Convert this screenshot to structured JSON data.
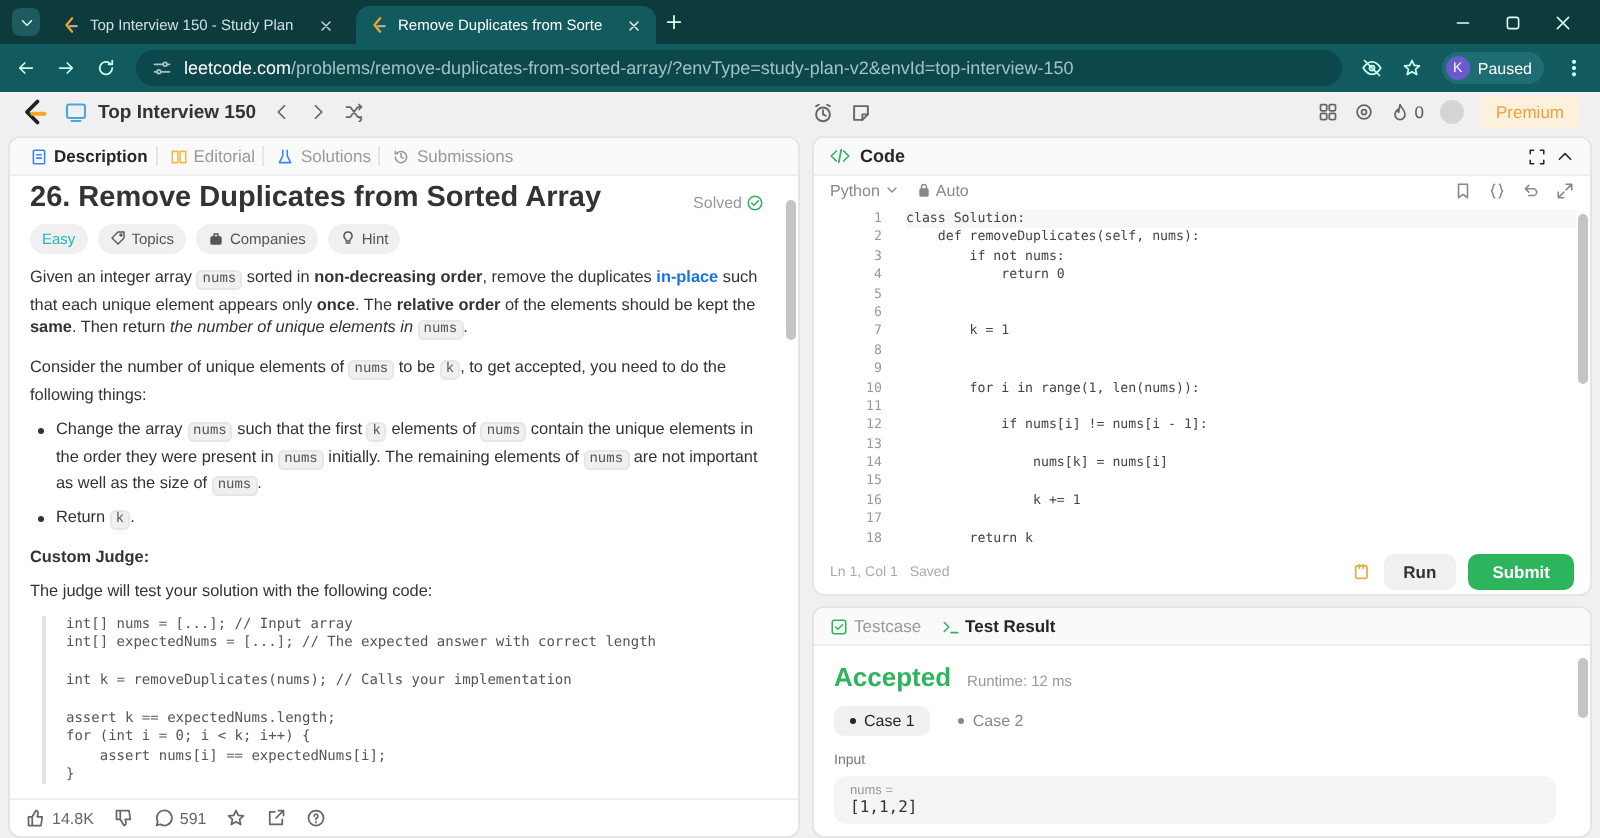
{
  "browser": {
    "tabs": [
      {
        "title": "Top Interview 150 - Study Plan",
        "selected": false
      },
      {
        "title": "Remove Duplicates from Sorte",
        "selected": true
      }
    ],
    "url_domain": "leetcode.com",
    "url_path": "/problems/remove-duplicates-from-sorted-array/?envType=study-plan-v2&envId=top-interview-150",
    "profile": {
      "initial": "K",
      "status": "Paused"
    }
  },
  "app_header": {
    "study_plan": "Top Interview 150",
    "streak": "0",
    "premium": "Premium"
  },
  "left_tabs": [
    {
      "label": "Description",
      "selected": true
    },
    {
      "label": "Editorial",
      "selected": false
    },
    {
      "label": "Solutions",
      "selected": false
    },
    {
      "label": "Submissions",
      "selected": false
    }
  ],
  "problem": {
    "title": "26. Remove Duplicates from Sorted Array",
    "status": "Solved",
    "difficulty": "Easy",
    "tags": [
      "Topics",
      "Companies",
      "Hint"
    ],
    "paragraphs": [
      [
        {
          "kind": "plain",
          "text": "Given an integer array "
        },
        {
          "kind": "code",
          "text": "nums"
        },
        {
          "kind": "plain",
          "text": " sorted in "
        },
        {
          "kind": "bold",
          "text": "non-decreasing order"
        },
        {
          "kind": "plain",
          "text": ", remove the duplicates "
        },
        {
          "kind": "link",
          "text": "in-place"
        },
        {
          "kind": "plain",
          "text": " such that each unique element appears only "
        },
        {
          "kind": "bold",
          "text": "once"
        },
        {
          "kind": "plain",
          "text": ". The "
        },
        {
          "kind": "bold",
          "text": "relative order"
        },
        {
          "kind": "plain",
          "text": " of the elements should be kept the "
        },
        {
          "kind": "bold",
          "text": "same"
        },
        {
          "kind": "plain",
          "text": ". Then return "
        },
        {
          "kind": "italic",
          "text": "the number of unique elements in "
        },
        {
          "kind": "code",
          "text": "nums"
        },
        {
          "kind": "plain",
          "text": "."
        }
      ],
      [
        {
          "kind": "plain",
          "text": "Consider the number of unique elements of "
        },
        {
          "kind": "code",
          "text": "nums"
        },
        {
          "kind": "plain",
          "text": " to be "
        },
        {
          "kind": "code",
          "text": "k"
        },
        {
          "kind": "plain",
          "text": ", to get accepted, you need to do the following things:"
        }
      ]
    ],
    "bullets": [
      [
        {
          "kind": "plain",
          "text": "Change the array "
        },
        {
          "kind": "code",
          "text": "nums"
        },
        {
          "kind": "plain",
          "text": " such that the first "
        },
        {
          "kind": "code",
          "text": "k"
        },
        {
          "kind": "plain",
          "text": " elements of "
        },
        {
          "kind": "code",
          "text": "nums"
        },
        {
          "kind": "plain",
          "text": " contain the unique elements in the order they were present in "
        },
        {
          "kind": "code",
          "text": "nums"
        },
        {
          "kind": "plain",
          "text": " initially. The remaining elements of "
        },
        {
          "kind": "code",
          "text": "nums"
        },
        {
          "kind": "plain",
          "text": " are not important as well as the size of "
        },
        {
          "kind": "code",
          "text": "nums"
        },
        {
          "kind": "plain",
          "text": "."
        }
      ],
      [
        {
          "kind": "plain",
          "text": "Return "
        },
        {
          "kind": "code",
          "text": "k"
        },
        {
          "kind": "plain",
          "text": "."
        }
      ]
    ],
    "judge_heading": "Custom Judge:",
    "judge_intro": "The judge will test your solution with the following code:",
    "judge_code": "int[] nums = [...]; // Input array\nint[] expectedNums = [...]; // The expected answer with correct length\n\nint k = removeDuplicates(nums); // Calls your implementation\n\nassert k == expectedNums.length;\nfor (int i = 0; i < k; i++) {\n    assert nums[i] == expectedNums[i];\n}",
    "likes": "14.8K",
    "comments": "591"
  },
  "editor": {
    "title": "Code",
    "language": "Python",
    "mode": "Auto",
    "lines": [
      {
        "number": "1",
        "text": "class Solution:"
      },
      {
        "number": "2",
        "text": "    def removeDuplicates(self, nums):"
      },
      {
        "number": "3",
        "text": "        if not nums:"
      },
      {
        "number": "4",
        "text": "            return 0"
      },
      {
        "number": "5"
      },
      {
        "number": "6"
      },
      {
        "number": "7",
        "text": "        k = 1"
      },
      {
        "number": "8"
      },
      {
        "number": "9"
      },
      {
        "number": "10",
        "text": "        for i in range(1, len(nums)):"
      },
      {
        "number": "11"
      },
      {
        "number": "12",
        "text": "            if nums[i] != nums[i - 1]:"
      },
      {
        "number": "13"
      },
      {
        "number": "14",
        "text": "                nums[k] = nums[i]"
      },
      {
        "number": "15"
      },
      {
        "number": "16",
        "text": "                k += 1"
      },
      {
        "number": "17"
      },
      {
        "number": "18",
        "text": "        return k"
      }
    ],
    "cursor": "Ln 1, Col 1",
    "save_state": "Saved",
    "run": "Run",
    "submit": "Submit"
  },
  "result": {
    "tabs": [
      {
        "label": "Testcase",
        "selected": false
      },
      {
        "label": "Test Result",
        "selected": true
      }
    ],
    "verdict": "Accepted",
    "runtime": "Runtime: 12 ms",
    "cases": [
      {
        "label": "Case 1",
        "selected": true
      },
      {
        "label": "Case 2",
        "selected": false
      }
    ],
    "input_label": "Input",
    "param": "nums =",
    "value": "[1,1,2]"
  }
}
